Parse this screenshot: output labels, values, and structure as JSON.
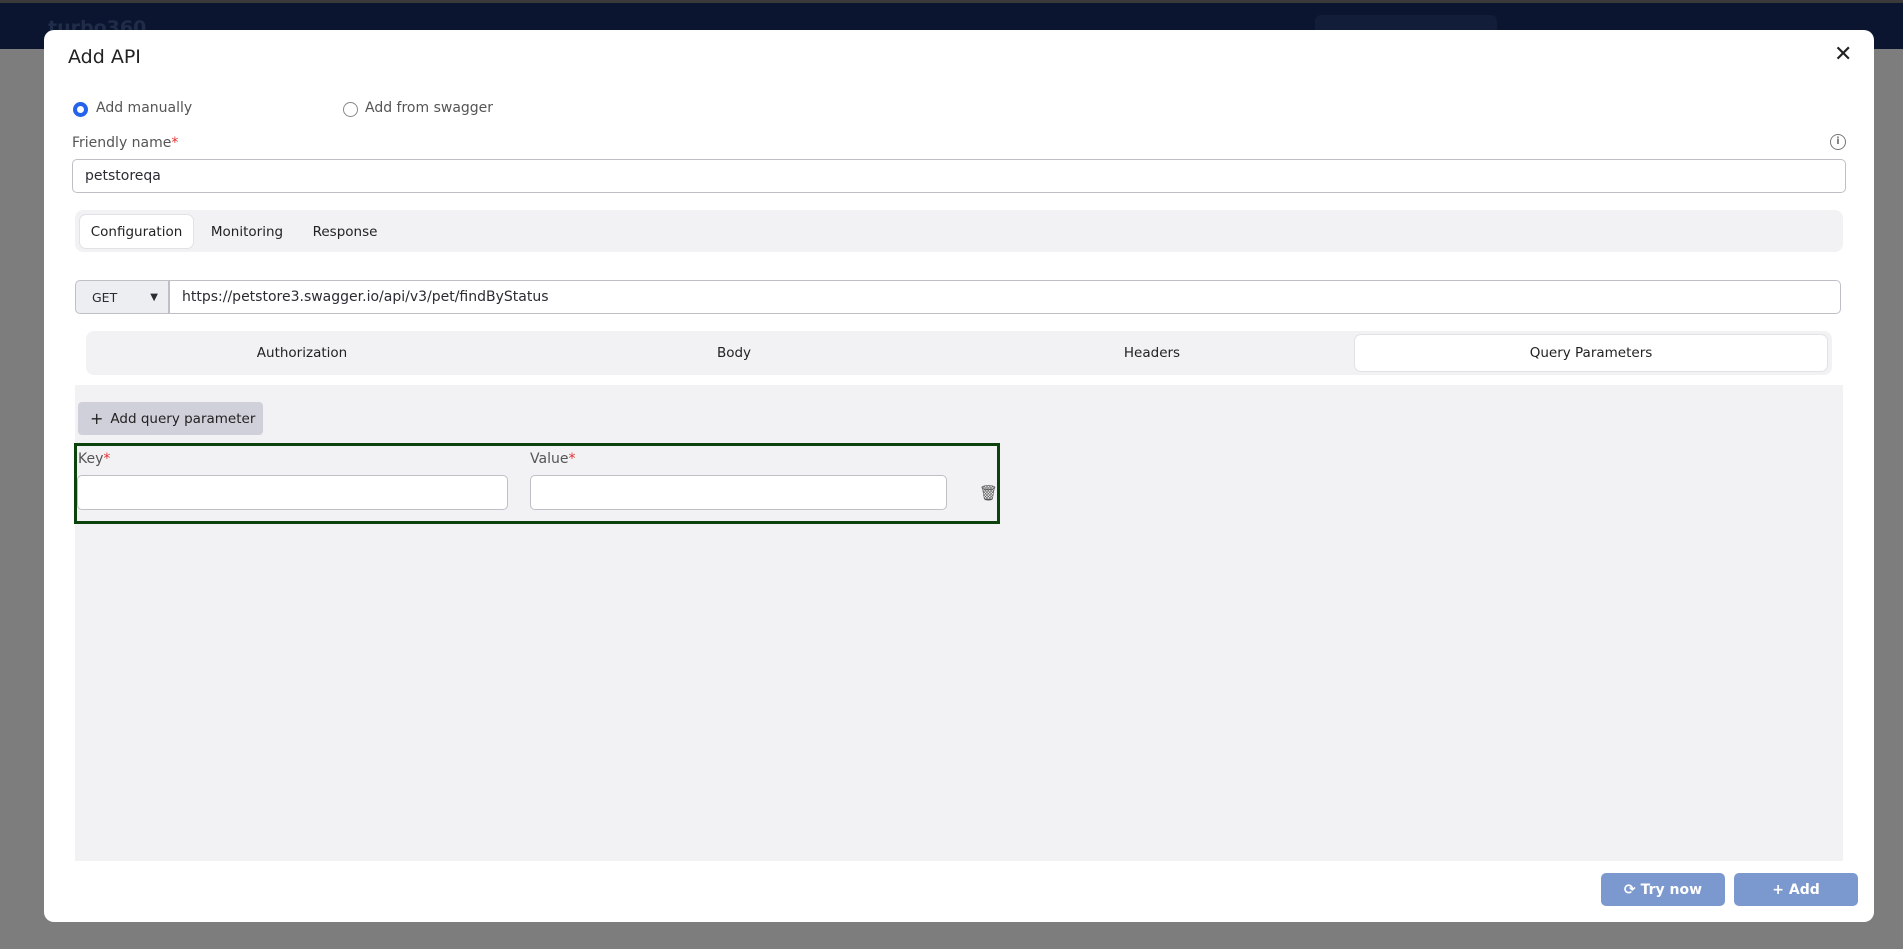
{
  "app": {
    "brand": "turbo360"
  },
  "dialog": {
    "title": "Add API",
    "close_icon": "close-icon",
    "mode_options": [
      {
        "label": "Add manually",
        "selected": true
      },
      {
        "label": "Add from swagger",
        "selected": false
      }
    ],
    "friendly_name": {
      "label": "Friendly name",
      "required_mark": "*",
      "value": "petstoreqa"
    },
    "tabs": [
      {
        "label": "Configuration",
        "active": true
      },
      {
        "label": "Monitoring",
        "active": false
      },
      {
        "label": "Response",
        "active": false
      }
    ],
    "request": {
      "method": "GET",
      "url": "https://petstore3.swagger.io/api/v3/pet/findByStatus"
    },
    "subtabs": [
      {
        "label": "Authorization",
        "active": false
      },
      {
        "label": "Body",
        "active": false
      },
      {
        "label": "Headers",
        "active": false
      },
      {
        "label": "Query Parameters",
        "active": true
      }
    ],
    "query": {
      "add_label": "Add query parameter",
      "key_label": "Key",
      "value_label": "Value",
      "required_mark": "*",
      "key_value": "",
      "value_value": ""
    },
    "buttons": {
      "try_now": "Try now",
      "add": "Add"
    },
    "colors": {
      "primary_button": "#7b98cf",
      "highlight_border": "#0c420c",
      "radio_selected": "#2563eb"
    }
  }
}
